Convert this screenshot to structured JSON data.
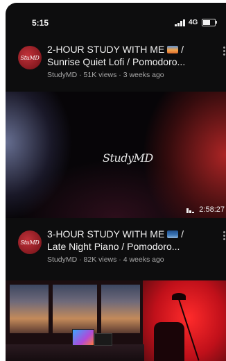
{
  "status_bar": {
    "time": "5:15",
    "network": "4G"
  },
  "videos": [
    {
      "title_line1": "2-HOUR STUDY WITH ME",
      "title_line1_suffix": "/",
      "title_line2": "Sunrise Quiet Lofi / Pomodoro...",
      "meta": "StudyMD · 51K views · 3 weeks ago",
      "avatar_text": "StuMD",
      "thumbnail_watermark": "StudyMD",
      "duration": "2:58:27"
    },
    {
      "title_line1": "3-HOUR STUDY WITH ME",
      "title_line1_suffix": "/",
      "title_line2": "Late Night Piano /  Pomodoro...",
      "meta": "StudyMD · 82K views · 4 weeks ago",
      "avatar_text": "StuMD"
    }
  ],
  "icons": {
    "signal": "signal-bars-icon",
    "battery": "battery-icon",
    "more": "more-vert-icon",
    "audio": "audio-bars-icon"
  }
}
